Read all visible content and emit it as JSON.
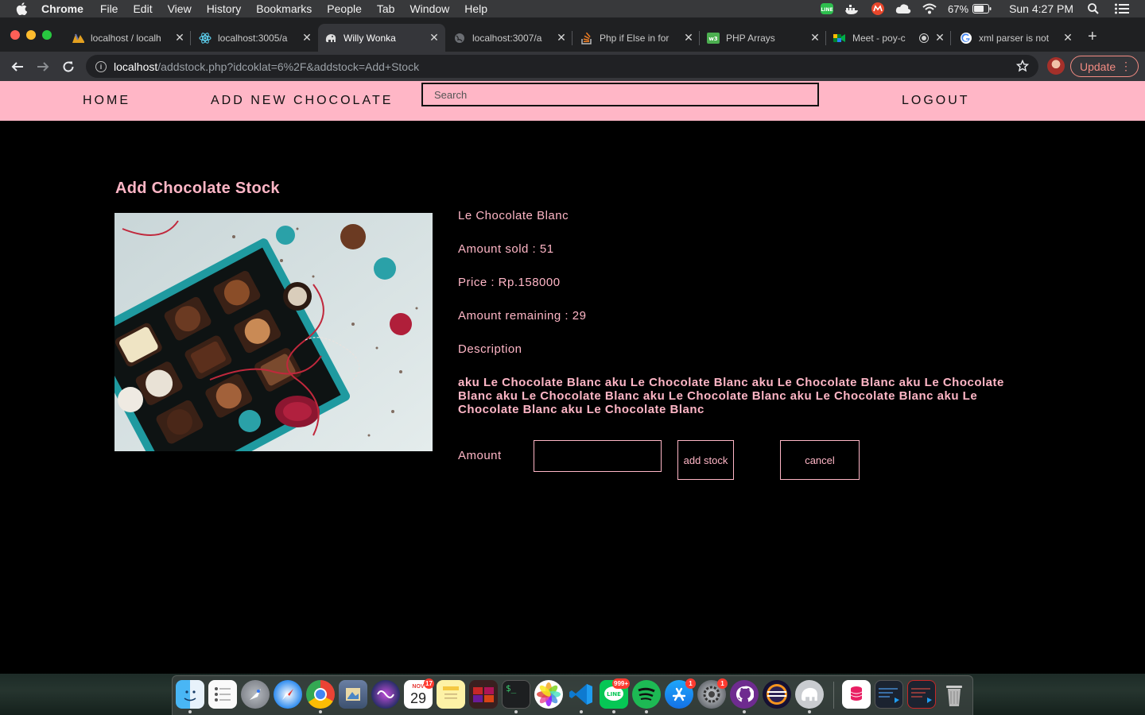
{
  "menubar": {
    "app_name": "Chrome",
    "items": [
      "File",
      "Edit",
      "View",
      "History",
      "Bookmarks",
      "People",
      "Tab",
      "Window",
      "Help"
    ],
    "battery_percent": "67%",
    "clock": "Sun 4:27 PM"
  },
  "tabs": [
    {
      "title": "localhost / localh",
      "icon": "phpmyadmin-icon"
    },
    {
      "title": "localhost:3005/a",
      "icon": "react-icon"
    },
    {
      "title": "Willy Wonka",
      "icon": "elephant-icon"
    },
    {
      "title": "localhost:3007/a",
      "icon": "globe-icon"
    },
    {
      "title": "Php if Else in for",
      "icon": "stackoverflow-icon"
    },
    {
      "title": "PHP Arrays",
      "icon": "w3schools-icon"
    },
    {
      "title": "Meet - poy-c",
      "icon": "google-meet-icon"
    },
    {
      "title": "xml parser is not",
      "icon": "google-icon"
    }
  ],
  "address_bar": {
    "host": "localhost",
    "path": "/addstock.php?idcoklat=6%2F&addstock=Add+Stock"
  },
  "update_button_label": "Update",
  "nav": {
    "home": "HOME",
    "add_new": "ADD NEW CHOCOLATE",
    "search_placeholder": "Search",
    "logout": "LOGOUT"
  },
  "page": {
    "heading": "Add Chocolate Stock",
    "product_name": "Le Chocolate Blanc",
    "amount_sold": "Amount sold : 51",
    "price": "Price : Rp.158000",
    "amount_remaining": "Amount remaining : 29",
    "description_label": "Description",
    "description_text": "aku Le Chocolate Blanc aku Le Chocolate Blanc aku Le Chocolate Blanc aku Le Chocolate Blanc aku Le Chocolate Blanc aku Le Chocolate Blanc aku Le Chocolate Blanc aku Le Chocolate Blanc aku Le Chocolate Blanc",
    "amount_label": "Amount",
    "amount_value": "",
    "add_stock_label": "add stock",
    "cancel_label": "cancel"
  },
  "dock": {
    "calendar_month": "NOV",
    "calendar_day": "29",
    "calendar_badge": "17",
    "line_badge": "999+",
    "appstore_badge": "1",
    "settings_badge": "1"
  },
  "colors": {
    "accent_pink": "#ffb6c6",
    "page_bg": "#000000",
    "menubar_bg": "#38393b",
    "chrome_tab_bg": "#1f2022",
    "chrome_toolbar_bg": "#35363a"
  }
}
